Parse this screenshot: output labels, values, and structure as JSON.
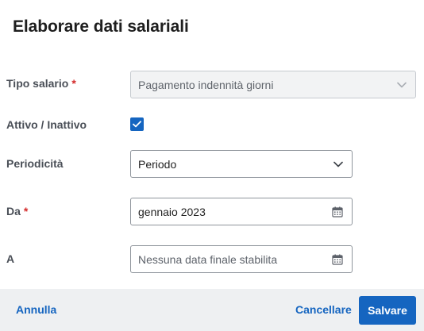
{
  "dialog": {
    "title": "Elaborare dati salariali"
  },
  "form": {
    "salary_type": {
      "label": "Tipo salario",
      "required_mark": "*",
      "value": "Pagamento indennità giorni",
      "disabled": true
    },
    "active": {
      "label": "Attivo / Inattivo",
      "checked": true
    },
    "periodicity": {
      "label": "Periodicità",
      "value": "Periodo"
    },
    "from": {
      "label": "Da",
      "required_mark": "*",
      "value": "gennaio 2023"
    },
    "to": {
      "label": "A",
      "placeholder": "Nessuna data finale stabilita"
    }
  },
  "footer": {
    "cancel_label": "Annulla",
    "delete_label": "Cancellare",
    "save_label": "Salvare"
  },
  "colors": {
    "accent": "#1565c0",
    "required": "#d42b2b",
    "footer_bg": "#eef0f2"
  }
}
